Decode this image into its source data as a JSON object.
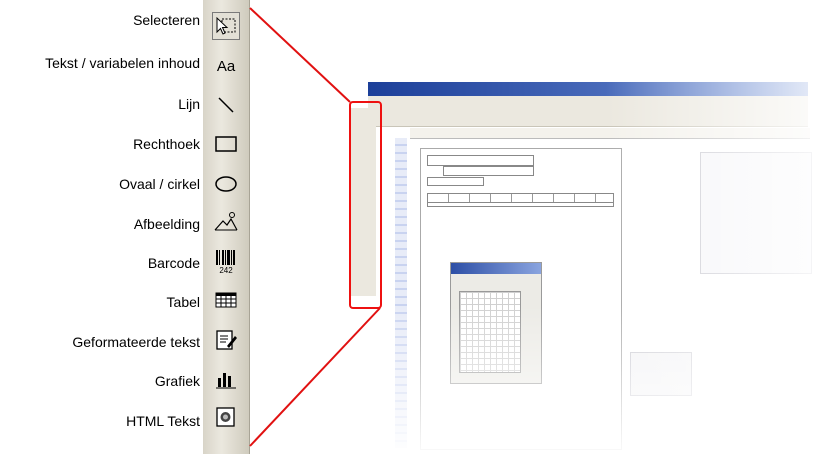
{
  "tools": [
    {
      "label": "Selecteren",
      "icon": "select-icon",
      "active": true
    },
    {
      "label": "Tekst / variabelen inhoud",
      "icon": "text-icon",
      "glyph": "Aa"
    },
    {
      "label": "Lijn",
      "icon": "line-icon"
    },
    {
      "label": "Rechthoek",
      "icon": "rectangle-icon"
    },
    {
      "label": "Ovaal / cirkel",
      "icon": "ellipse-icon"
    },
    {
      "label": "Afbeelding",
      "icon": "image-icon"
    },
    {
      "label": "Barcode",
      "icon": "barcode-icon",
      "glyph": "242"
    },
    {
      "label": "Tabel",
      "icon": "table-icon"
    },
    {
      "label": "Geformateerde tekst",
      "icon": "formatted-text-icon"
    },
    {
      "label": "Grafiek",
      "icon": "chart-icon"
    },
    {
      "label": "HTML Tekst",
      "icon": "html-text-icon"
    }
  ],
  "accent_color": "#e11111"
}
